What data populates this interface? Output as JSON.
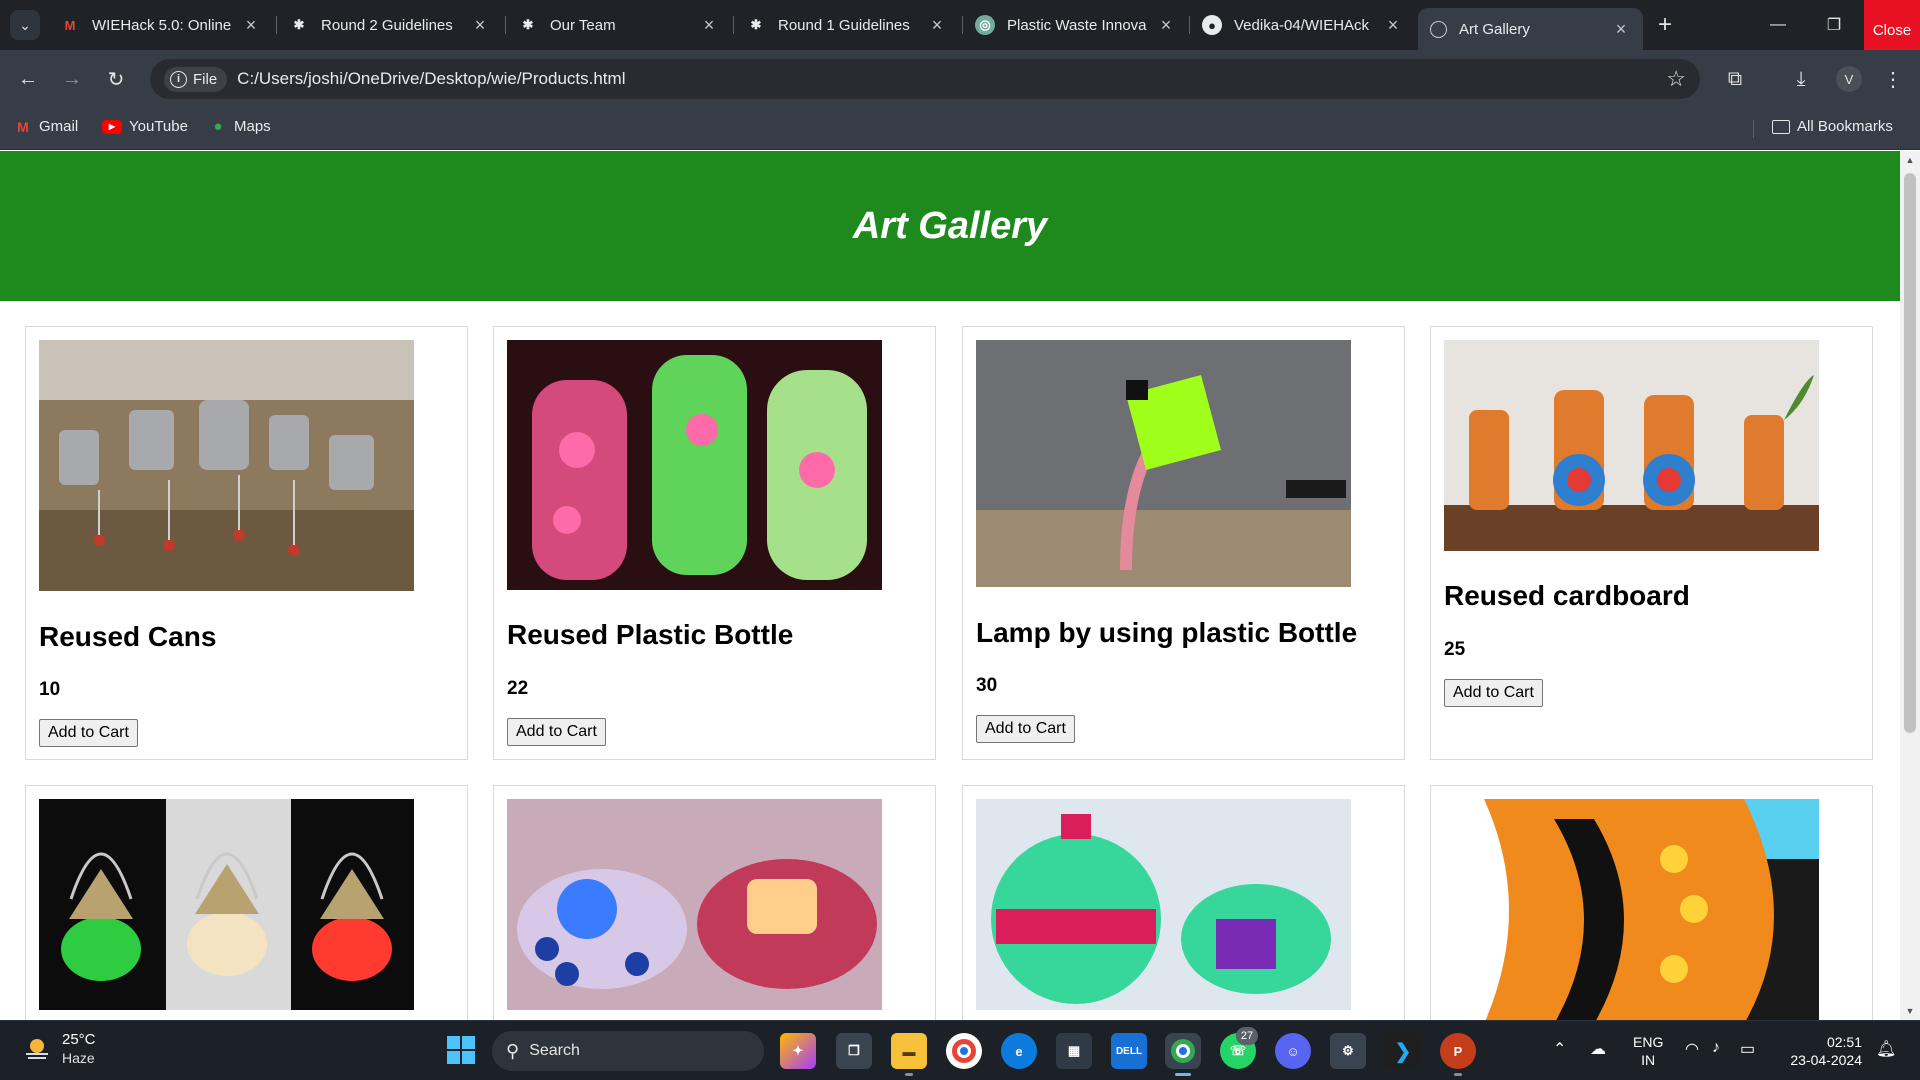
{
  "browser": {
    "tabs": [
      {
        "title": "WIEHack 5.0: Online",
        "favicon": "gmail-icon",
        "active": false
      },
      {
        "title": "Round 2 Guidelines",
        "favicon": "gear-people-icon",
        "active": false
      },
      {
        "title": "Our Team",
        "favicon": "gear-people-icon",
        "active": false
      },
      {
        "title": "Round 1 Guidelines",
        "favicon": "gear-people-icon",
        "active": false
      },
      {
        "title": "Plastic Waste Innova",
        "favicon": "chatgpt-icon",
        "active": false
      },
      {
        "title": "Vedika-04/WIEHAck",
        "favicon": "github-icon",
        "active": false
      },
      {
        "title": "Art Gallery",
        "favicon": "globe-icon",
        "active": true
      }
    ],
    "window_close_label": "Close",
    "address": {
      "scheme_chip": "File",
      "url": "C:/Users/joshi/OneDrive/Desktop/wie/Products.html"
    },
    "profile_initial": "V",
    "bookmarks": [
      {
        "label": "Gmail",
        "icon": "gmail-icon"
      },
      {
        "label": "YouTube",
        "icon": "youtube-icon"
      },
      {
        "label": "Maps",
        "icon": "maps-pin-icon"
      }
    ],
    "all_bookmarks_label": "All Bookmarks"
  },
  "page": {
    "title": "Art Gallery",
    "header_color": "#1e8a1e",
    "products": [
      {
        "name": "Reused Cans",
        "price": "10",
        "button": "Add to Cart",
        "image": "hanging tin-can wind chimes"
      },
      {
        "name": "Reused Plastic Bottle",
        "price": "22",
        "button": "Add to Cart",
        "image": "painted glowing bottle lamps"
      },
      {
        "name": "Lamp by using plastic Bottle",
        "price": "30",
        "button": "Add to Cart",
        "image": "green bottle desk lamp"
      },
      {
        "name": "Reused cardboard",
        "price": "25",
        "button": "Add to Cart",
        "image": "cardboard musician figurines"
      },
      {
        "name": "",
        "price": "",
        "button": "",
        "image": "beaded lanterns"
      },
      {
        "name": "",
        "price": "",
        "button": "",
        "image": "tea-light candle holders"
      },
      {
        "name": "",
        "price": "",
        "button": "",
        "image": "bottle trinket boxes"
      },
      {
        "name": "",
        "price": "",
        "button": "",
        "image": "bottle-cap mosaic"
      }
    ]
  },
  "taskbar": {
    "weather_temp": "25°C",
    "weather_condition": "Haze",
    "search_placeholder": "Search",
    "notification_count": "27",
    "language_line1": "ENG",
    "language_line2": "IN",
    "time": "02:51",
    "date": "23-04-2024"
  }
}
